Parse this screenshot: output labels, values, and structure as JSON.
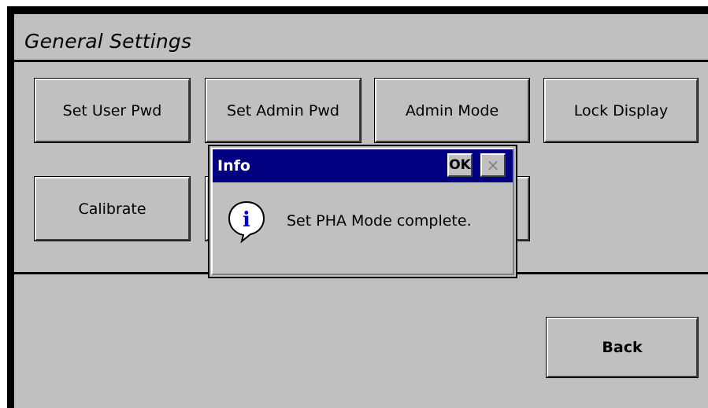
{
  "window": {
    "title": "General Settings"
  },
  "buttons": {
    "set_user_pwd": "Set User Pwd",
    "set_admin_pwd": "Set Admin Pwd",
    "admin_mode": "Admin Mode",
    "lock_display": "Lock Display",
    "calibrate": "Calibrate",
    "back": "Back"
  },
  "dialog": {
    "title": "Info",
    "ok_label": "OK",
    "close_label": "×",
    "icon": "info-icon",
    "message": "Set PHA Mode complete."
  },
  "colors": {
    "panel_bg": "#c0c0c0",
    "titlebar_bg": "#000080",
    "frame": "#000000"
  }
}
